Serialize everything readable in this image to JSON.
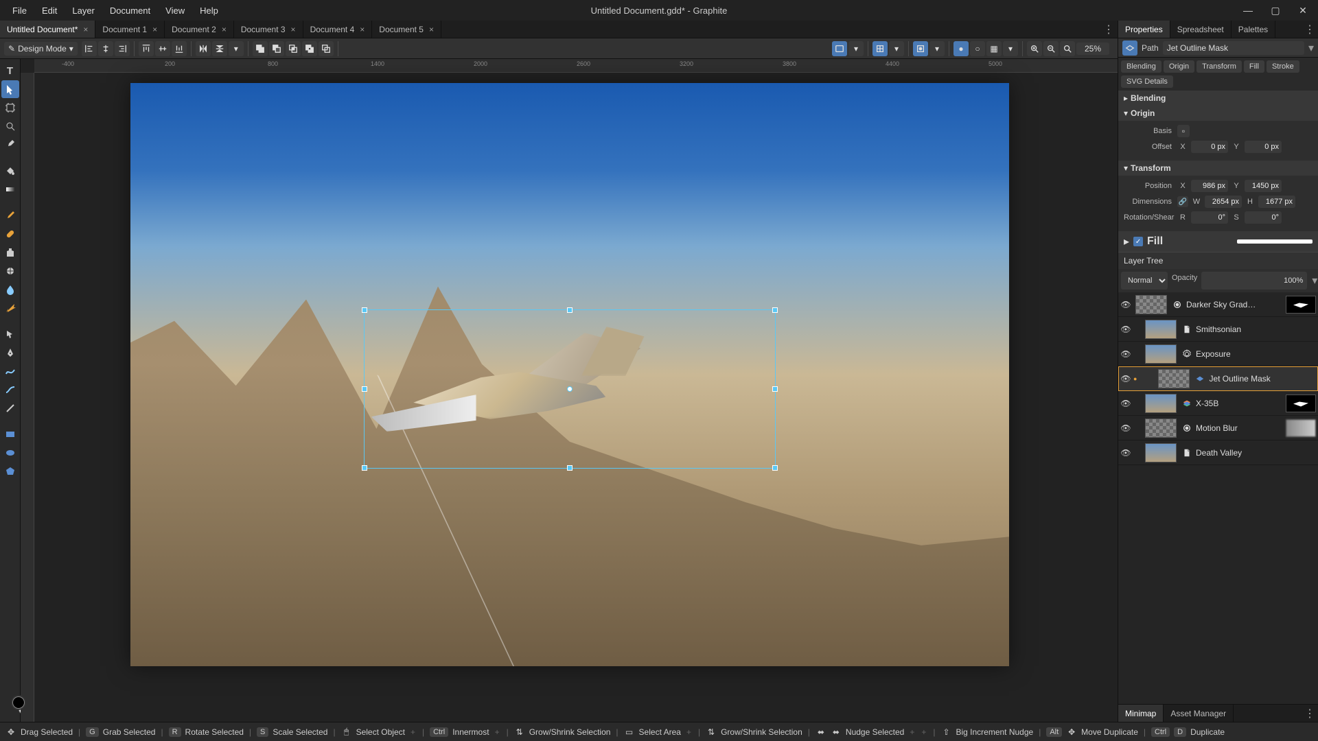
{
  "app": {
    "title": "Untitled Document.gdd* - Graphite"
  },
  "menu": [
    "File",
    "Edit",
    "Layer",
    "Document",
    "View",
    "Help"
  ],
  "doc_tabs": [
    {
      "label": "Untitled Document*",
      "active": true
    },
    {
      "label": "Document 1",
      "active": false
    },
    {
      "label": "Document 2",
      "active": false
    },
    {
      "label": "Document 3",
      "active": false
    },
    {
      "label": "Document 4",
      "active": false
    },
    {
      "label": "Document 5",
      "active": false
    }
  ],
  "mode": "Design Mode",
  "zoom": "25%",
  "ruler_marks": [
    "-400",
    "200",
    "800",
    "1400",
    "2000",
    "2600",
    "3200",
    "3800",
    "4400",
    "5000"
  ],
  "panel_tabs": [
    "Properties",
    "Spreadsheet",
    "Palettes"
  ],
  "path": {
    "label": "Path",
    "value": "Jet Outline Mask"
  },
  "chips": [
    "Blending",
    "Origin",
    "Transform",
    "Fill",
    "Stroke"
  ],
  "svg_details": "SVG Details",
  "sections": {
    "blending": "Blending",
    "origin": "Origin",
    "transform": "Transform",
    "fill": "Fill"
  },
  "origin": {
    "basis_label": "Basis",
    "offset_label": "Offset",
    "x": "0 px",
    "y": "0 px"
  },
  "transform": {
    "position_label": "Position",
    "px": "986 px",
    "py": "1450 px",
    "dimensions_label": "Dimensions",
    "w": "2654 px",
    "h": "1677 px",
    "rotshear_label": "Rotation/Shear",
    "r": "0°",
    "s": "0°"
  },
  "axis": {
    "x": "X",
    "y": "Y",
    "w": "W",
    "h": "H",
    "r": "R",
    "s": "S"
  },
  "fill_checked": true,
  "layer_tree": {
    "title": "Layer Tree",
    "blend_mode": "Normal",
    "opacity_label": "Opacity",
    "opacity": "100%"
  },
  "layers": [
    {
      "name": "Darker Sky Grad…",
      "type": "adjust",
      "indent": 0,
      "selected": false,
      "checker": true,
      "mask": true
    },
    {
      "name": "Smithsonian",
      "type": "doc",
      "indent": 1,
      "selected": false
    },
    {
      "name": "Exposure",
      "type": "adjust-gear",
      "indent": 1,
      "selected": false
    },
    {
      "name": "Jet Outline Mask",
      "type": "vector",
      "indent": 2,
      "selected": true,
      "checker": true
    },
    {
      "name": "X-35B",
      "type": "stack",
      "indent": 1,
      "selected": false,
      "mask": true
    },
    {
      "name": "Motion Blur",
      "type": "adjust",
      "indent": 1,
      "selected": false,
      "checker": true,
      "trail": true
    },
    {
      "name": "Death Valley",
      "type": "doc",
      "indent": 1,
      "selected": false
    }
  ],
  "bottom_panel_tabs": [
    "Minimap",
    "Asset Manager"
  ],
  "status_hints": [
    {
      "icon": "drag",
      "text": "Drag Selected"
    },
    {
      "key": "G",
      "text": "Grab Selected"
    },
    {
      "key": "R",
      "text": "Rotate Selected"
    },
    {
      "key": "S",
      "text": "Scale Selected"
    },
    {
      "icon": "click",
      "text": "Select Object",
      "plus": true
    },
    {
      "key": "Ctrl",
      "text": "Innermost",
      "plus": true
    },
    {
      "icon": "updown",
      "text": "Grow/Shrink Selection"
    },
    {
      "icon": "box",
      "text": "Select Area",
      "plus": true
    },
    {
      "icon": "updown",
      "text": "Grow/Shrink Selection"
    },
    {
      "icon": "arrows",
      "plus": true,
      "icon2": "arrows",
      "text": "Nudge Selected",
      "plus2": true
    },
    {
      "icon": "shift",
      "text": "Big Increment Nudge"
    },
    {
      "key": "Alt",
      "icon": "drag",
      "text": "Move Duplicate"
    },
    {
      "key": "Ctrl",
      "key2": "D",
      "text": "Duplicate"
    }
  ]
}
